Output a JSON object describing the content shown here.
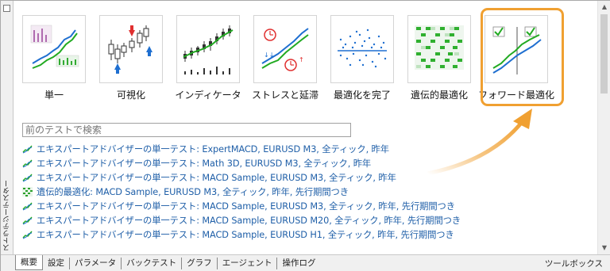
{
  "sidebar": {
    "vertical_label": "ストラテジーテスター"
  },
  "modes": [
    {
      "label": "単一",
      "icon": "single-test-icon"
    },
    {
      "label": "可視化",
      "icon": "visualization-icon"
    },
    {
      "label": "インディケータ",
      "icon": "indicator-icon"
    },
    {
      "label": "ストレスと延滞",
      "icon": "stress-delay-icon"
    },
    {
      "label": "最適化を完了",
      "icon": "complete-optimization-icon"
    },
    {
      "label": "遺伝的最適化",
      "icon": "genetic-optimization-icon"
    },
    {
      "label": "フォワード最適化",
      "icon": "forward-optimization-icon"
    }
  ],
  "search": {
    "placeholder": "前のテストで検索"
  },
  "history": [
    {
      "text": "エキスパートアドバイザーの単一テスト: ExpertMACD, EURUSD M3, 全ティック, 昨年",
      "icon": "single-test-icon"
    },
    {
      "text": "エキスパートアドバイザーの単一テスト: Math 3D, EURUSD M3, 全ティック, 昨年",
      "icon": "single-test-icon"
    },
    {
      "text": "エキスパートアドバイザーの単一テスト: MACD Sample, EURUSD M3, 全ティック, 昨年",
      "icon": "single-test-icon"
    },
    {
      "text": "遺伝的最適化: MACD Sample, EURUSD M3, 全ティック, 昨年, 先行期間つき",
      "icon": "genetic-optimization-icon"
    },
    {
      "text": "エキスパートアドバイザーの単一テスト: MACD Sample, EURUSD M3, 全ティック, 昨年, 先行期間つき",
      "icon": "single-test-icon"
    },
    {
      "text": "エキスパートアドバイザーの単一テスト: MACD Sample, EURUSD M20, 全ティック, 昨年, 先行期間つき",
      "icon": "single-test-icon"
    },
    {
      "text": "エキスパートアドバイザーの単一テスト: MACD Sample, EURUSD H1, 全ティック, 昨年, 先行期間つき",
      "icon": "single-test-icon"
    }
  ],
  "tabs": [
    {
      "label": "概要",
      "active": true
    },
    {
      "label": "設定",
      "active": false
    },
    {
      "label": "パラメータ",
      "active": false
    },
    {
      "label": "バックテスト",
      "active": false
    },
    {
      "label": "グラフ",
      "active": false
    },
    {
      "label": "エージェント",
      "active": false
    },
    {
      "label": "操作ログ",
      "active": false
    }
  ],
  "toolbox_label": "ツールボックス",
  "colors": {
    "accent": "#f0a031",
    "link": "#1f5fa8",
    "green": "#22aa22",
    "blue": "#1f6fd0"
  }
}
